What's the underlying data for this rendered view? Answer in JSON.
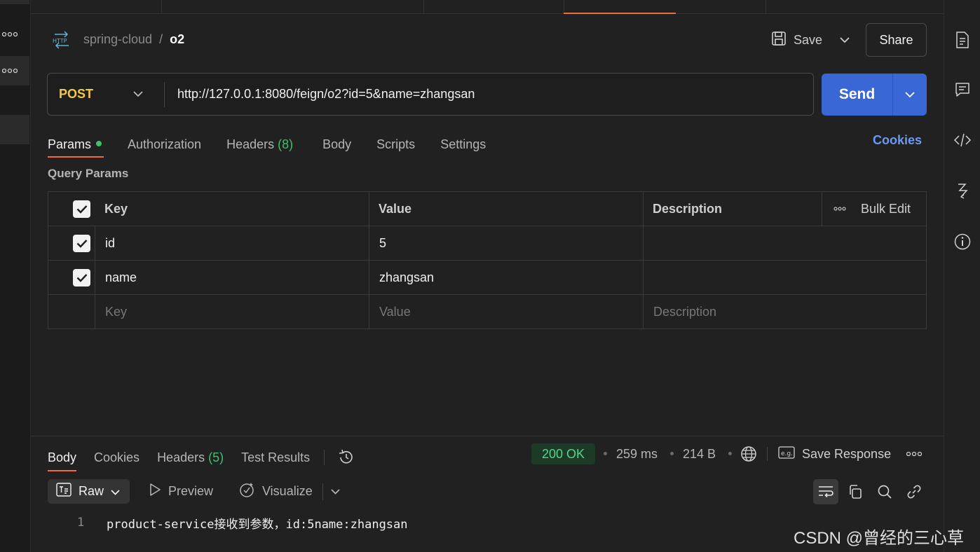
{
  "breadcrumb": {
    "collection": "spring-cloud",
    "separator": "/",
    "request_name": "o2"
  },
  "header": {
    "save_label": "Save",
    "share_label": "Share"
  },
  "request": {
    "method": "POST",
    "url": "http://127.0.0.1:8080/feign/o2?id=5&name=zhangsan",
    "send_label": "Send"
  },
  "request_tabs": {
    "params": "Params",
    "authorization": "Authorization",
    "headers": "Headers",
    "headers_count": "(8)",
    "body": "Body",
    "scripts": "Scripts",
    "settings": "Settings",
    "cookies": "Cookies"
  },
  "query_params": {
    "title": "Query Params",
    "columns": {
      "key": "Key",
      "value": "Value",
      "description": "Description",
      "bulk_edit": "Bulk Edit"
    },
    "rows": [
      {
        "key": "id",
        "value": "5",
        "description": ""
      },
      {
        "key": "name",
        "value": "zhangsan",
        "description": ""
      }
    ],
    "placeholders": {
      "key": "Key",
      "value": "Value",
      "description": "Description"
    }
  },
  "response": {
    "tabs": {
      "body": "Body",
      "cookies": "Cookies",
      "headers": "Headers",
      "headers_count": "(5)",
      "test_results": "Test Results"
    },
    "status": "200 OK",
    "time": "259 ms",
    "size": "214 B",
    "save_response": "Save Response",
    "formats": {
      "raw": "Raw",
      "preview": "Preview",
      "visualize": "Visualize"
    },
    "body_lines": [
      {
        "n": "1",
        "text": "product-service接收到参数，id:5name:zhangsan"
      }
    ]
  },
  "watermark": "CSDN @曾经的三心草",
  "colors": {
    "accent": "#f26b3a",
    "send": "#3a67d6",
    "method": "#f5c842",
    "status": "#57d38c",
    "link": "#6a9af5"
  },
  "icons": [
    "http-icon",
    "save-icon",
    "chevron-down-icon",
    "more-icon",
    "history-icon",
    "globe-icon",
    "example-icon",
    "raw-text-icon",
    "play-icon",
    "visualize-icon",
    "wrap-icon",
    "copy-icon",
    "search-icon",
    "link-icon",
    "docs-icon",
    "comment-icon",
    "code-icon",
    "related-icon",
    "info-icon"
  ]
}
